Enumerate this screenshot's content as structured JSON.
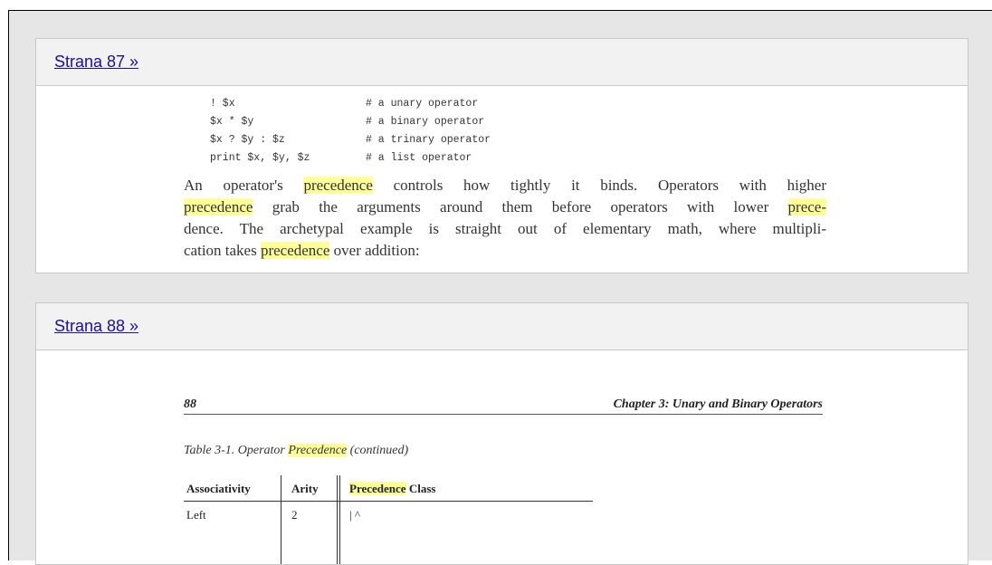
{
  "results": [
    {
      "link_label": "Strana 87 »",
      "code_lines": [
        {
          "stmt": "! $x",
          "comment": "# a unary operator"
        },
        {
          "stmt": "$x * $y",
          "comment": "# a binary operator"
        },
        {
          "stmt": "$x ? $y : $z",
          "comment": "# a trinary operator"
        },
        {
          "stmt": "print $x, $y, $z",
          "comment": "# a list operator"
        }
      ],
      "paragraph": {
        "l1a": "An operator's ",
        "l1hl": "precedence",
        "l1b": " controls how tightly it binds. Operators with higher",
        "l2hl": "precedence",
        "l2a": " grab the arguments around them before operators with lower ",
        "l2hl2": "prece-",
        "l3": "dence. The archetypal example is straight out of elementary math, where multipli-",
        "l4a": "cation takes ",
        "l4hl": "precedence",
        "l4b": " over addition:"
      }
    },
    {
      "link_label": "Strana 88 »",
      "page_number": "88",
      "chapter_title": "Chapter 3: Unary and Binary Operators",
      "caption_prefix": "Table 3-1.  Operator ",
      "caption_hl": "Precedence",
      "caption_suffix": "  (continued)",
      "table": {
        "col1": "Associativity",
        "col2": "Arity",
        "col3_hl": "Precedence",
        "col3_rest": " Class",
        "row1": {
          "assoc": "Left",
          "arity": "2",
          "class": "| ^"
        }
      }
    }
  ]
}
